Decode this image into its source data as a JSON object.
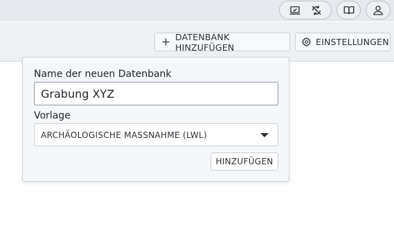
{
  "topbar": {
    "icons": [
      "laptop-icon",
      "sync-off-icon",
      "book-icon",
      "user-icon"
    ]
  },
  "toolbar": {
    "add_database_label": "DATENBANK HINZUFÜGEN",
    "settings_label": "EINSTELLUNGEN"
  },
  "popover": {
    "name_label": "Name der neuen Datenbank",
    "name_value": "Grabung XYZ",
    "template_label": "Vorlage",
    "template_selected": "ARCHÄOLOGISCHE MASSNAHME (LWL)",
    "submit_label": "HINZUFÜGEN"
  },
  "colors": {
    "topbar_bg": "#e6e9ed",
    "toolbar_bg": "#eef1f4",
    "popover_bg": "#f5f7f9"
  }
}
